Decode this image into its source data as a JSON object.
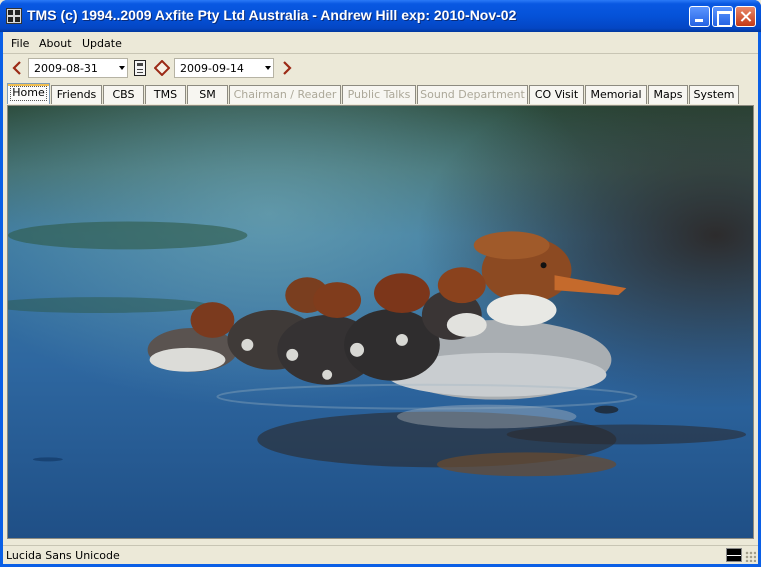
{
  "window": {
    "title": "TMS (c) 1994..2009 Axfite Pty Ltd Australia - Andrew Hill exp: 2010-Nov-02"
  },
  "menu": {
    "items": [
      "File",
      "About",
      "Update"
    ]
  },
  "toolbar": {
    "start_date": "2009-08-31",
    "end_date": "2009-09-14"
  },
  "tabs": [
    {
      "label": "Home",
      "state": "selected"
    },
    {
      "label": "Friends",
      "state": "enabled"
    },
    {
      "label": "CBS",
      "state": "enabled"
    },
    {
      "label": "TMS",
      "state": "enabled"
    },
    {
      "label": "SM",
      "state": "enabled"
    },
    {
      "label": "Chairman / Reader",
      "state": "disabled"
    },
    {
      "label": "Public Talks",
      "state": "disabled"
    },
    {
      "label": "Sound Department",
      "state": "disabled"
    },
    {
      "label": "CO Visit",
      "state": "enabled"
    },
    {
      "label": "Memorial",
      "state": "enabled"
    },
    {
      "label": "Maps",
      "state": "enabled"
    },
    {
      "label": "System",
      "state": "enabled"
    }
  ],
  "status": {
    "text": "Lucida Sans Unicode"
  },
  "colors": {
    "title_bar": "#0552d8",
    "window_bg": "#ece9d8",
    "nav_arrow": "#9b2a16",
    "disabled_text": "#aca899"
  }
}
